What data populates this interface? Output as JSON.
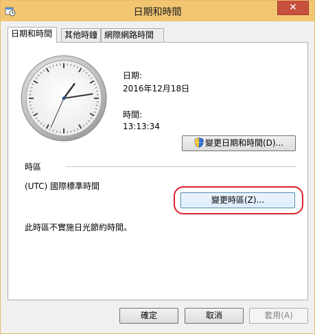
{
  "window": {
    "title": "日期和時間",
    "close_glyph": "✕"
  },
  "tabs": [
    {
      "label": "日期和時間",
      "active": true
    },
    {
      "label": "其他時鐘",
      "active": false
    },
    {
      "label": "網際網路時間",
      "active": false
    }
  ],
  "datetime": {
    "date_label": "日期:",
    "date_value": "2016年12月18日",
    "time_label": "時間:",
    "time_value": "13:13:34",
    "change_datetime_button": "變更日期和時間(D)..."
  },
  "timezone": {
    "section_label": "時區",
    "value": "(UTC) 國際標準時間",
    "change_timezone_button": "變更時區(Z)...",
    "dst_note": "此時區不實施日光節約時間。"
  },
  "footer": {
    "ok": "確定",
    "cancel": "取消",
    "apply": "套用(A)"
  },
  "icons": {
    "app": "clock-settings-icon",
    "shield": "uac-shield-icon",
    "close": "close-icon"
  },
  "colors": {
    "titlebar": "#f2c671",
    "close_button": "#c7503f",
    "highlight_annotation": "#d9212a"
  }
}
